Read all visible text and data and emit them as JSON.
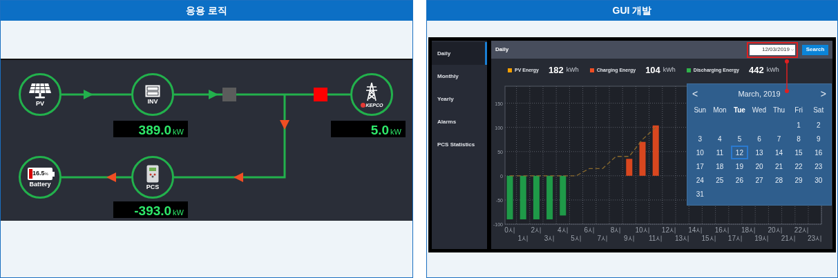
{
  "left_panel": {
    "title": "응용 로직",
    "diagram": {
      "nodes": [
        {
          "kind": "pv",
          "label": "PV"
        },
        {
          "kind": "inverter",
          "label": "INV",
          "reading": {
            "value": "389.0",
            "unit": "kW"
          }
        },
        {
          "kind": "grid",
          "logo_text": "KEPCO",
          "reading": {
            "value": "5.0",
            "unit": "kW"
          }
        },
        {
          "kind": "pcs",
          "label": "PCS",
          "reading": {
            "value": "-393.0",
            "unit": "kW"
          }
        },
        {
          "kind": "battery",
          "label": "Battery",
          "charge": "16.5",
          "charge_unit": "%",
          "level": 0.165
        }
      ],
      "breakers": [
        {
          "color": "#5c5c5c"
        },
        {
          "color": "#ff0000"
        }
      ],
      "flow_arrows": [
        {
          "color": "#22b14c"
        },
        {
          "color": "#22b14c"
        },
        {
          "color": "#f04e23"
        },
        {
          "color": "#f04e23"
        },
        {
          "color": "#f04e23"
        }
      ]
    }
  },
  "right_panel": {
    "title": "GUI 개발",
    "sidebar": {
      "items": [
        {
          "label": "Daily",
          "selected": true
        },
        {
          "label": "Monthly",
          "selected": false
        },
        {
          "label": "Yearly",
          "selected": false
        },
        {
          "label": "Alarms",
          "selected": false
        },
        {
          "label": "PCS Statistics",
          "selected": false
        }
      ]
    },
    "header": {
      "title": "Daily",
      "date_field": {
        "value": "12/03/2019"
      },
      "search_button": "Search"
    },
    "summary": [
      {
        "color": "#f59f00",
        "value": "182",
        "unit": "kWh"
      },
      {
        "color": "#f04e23",
        "value": "104",
        "unit": "kWh"
      },
      {
        "color": "#2fb34a",
        "value": "442",
        "unit": "kWh"
      }
    ],
    "chart_data": {
      "type": "bar",
      "stacked": true,
      "grid": true,
      "categories": [
        "0시",
        "1시",
        "2시",
        "3시",
        "4시",
        "5시",
        "6시",
        "7시",
        "8시",
        "9시",
        "10시",
        "11시",
        "12시",
        "13시",
        "14시",
        "15시",
        "16시",
        "17시",
        "18시",
        "19시",
        "20시",
        "21시",
        "22시",
        "23시"
      ],
      "ylim": [
        -100,
        185
      ],
      "yticks": [
        -100,
        -50,
        0,
        50,
        100,
        150
      ],
      "series": [
        {
          "name": "PV Energy",
          "type": "line",
          "line_style": "dashed",
          "color": "#8a6a2c",
          "values": [
            0,
            0,
            0,
            0,
            0,
            0,
            15,
            15,
            40,
            40,
            75,
            100,
            null,
            null,
            null,
            null,
            null,
            null,
            null,
            null,
            null,
            null,
            null,
            null
          ]
        },
        {
          "name": "Charging Energy",
          "type": "bar",
          "color": "#d9471f",
          "values": [
            null,
            null,
            null,
            null,
            null,
            null,
            null,
            null,
            null,
            35,
            70,
            104,
            null,
            null,
            null,
            null,
            null,
            null,
            null,
            null,
            null,
            null,
            null,
            null
          ]
        },
        {
          "name": "Discharging Energy",
          "type": "bar",
          "color": "#1f9a48",
          "values": [
            -90,
            -90,
            -90,
            -90,
            -82,
            null,
            null,
            null,
            null,
            null,
            null,
            null,
            null,
            null,
            null,
            null,
            null,
            null,
            null,
            null,
            null,
            null,
            null,
            null
          ]
        }
      ]
    },
    "calendar": {
      "month": "March, 2019",
      "prev": "<",
      "next": ">",
      "weekdays": [
        {
          "label": "Sun",
          "selected": false
        },
        {
          "label": "Mon",
          "selected": false
        },
        {
          "label": "Tue",
          "selected": true
        },
        {
          "label": "Wed",
          "selected": false
        },
        {
          "label": "Thu",
          "selected": false
        },
        {
          "label": "Fri",
          "selected": false
        },
        {
          "label": "Sat",
          "selected": false
        }
      ],
      "weeks": [
        [
          {
            "day": "1",
            "selected": false
          },
          {
            "day": "2",
            "selected": false
          }
        ],
        [
          {
            "day": "3",
            "selected": false
          },
          {
            "day": "4",
            "selected": false
          },
          {
            "day": "5",
            "selected": false
          },
          {
            "day": "6",
            "selected": false
          },
          {
            "day": "7",
            "selected": false
          },
          {
            "day": "8",
            "selected": false
          },
          {
            "day": "9",
            "selected": false
          }
        ],
        [
          {
            "day": "10",
            "selected": false
          },
          {
            "day": "11",
            "selected": false
          },
          {
            "day": "12",
            "selected": true
          },
          {
            "day": "13",
            "selected": false
          },
          {
            "day": "14",
            "selected": false
          },
          {
            "day": "15",
            "selected": false
          },
          {
            "day": "16",
            "selected": false
          }
        ],
        [
          {
            "day": "17",
            "selected": false
          },
          {
            "day": "18",
            "selected": false
          },
          {
            "day": "19",
            "selected": false
          },
          {
            "day": "20",
            "selected": false
          },
          {
            "day": "21",
            "selected": false
          },
          {
            "day": "22",
            "selected": false
          },
          {
            "day": "23",
            "selected": false
          }
        ],
        [
          {
            "day": "24",
            "selected": false
          },
          {
            "day": "25",
            "selected": false
          },
          {
            "day": "26",
            "selected": false
          },
          {
            "day": "27",
            "selected": false
          },
          {
            "day": "28",
            "selected": false
          },
          {
            "day": "29",
            "selected": false
          },
          {
            "day": "30",
            "selected": false
          }
        ],
        [
          {
            "day": "31",
            "selected": false
          }
        ]
      ]
    }
  }
}
